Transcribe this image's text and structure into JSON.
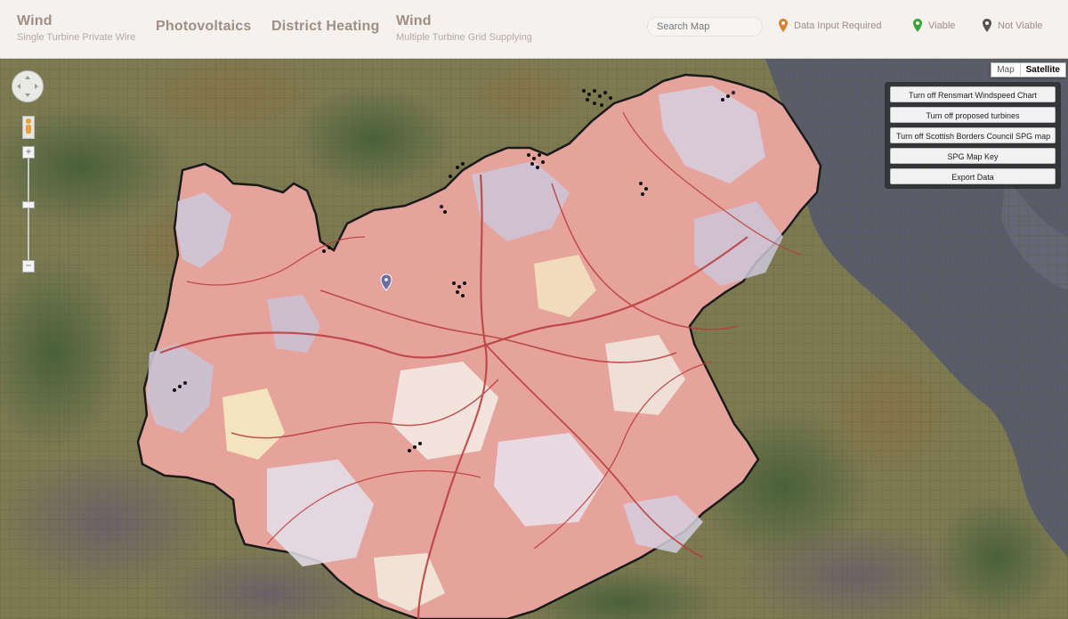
{
  "nav": {
    "items": [
      {
        "title": "Wind",
        "subtitle": "Single Turbine Private Wire"
      },
      {
        "title": "Photovoltaics",
        "subtitle": ""
      },
      {
        "title": "District Heating",
        "subtitle": ""
      },
      {
        "title": "Wind",
        "subtitle": "Multiple Turbine Grid Supplying"
      }
    ]
  },
  "search": {
    "placeholder": "Search Map"
  },
  "legend": {
    "items": [
      {
        "label": "Data Input Required",
        "color": "#d9822b",
        "icon": "map-pin-icon"
      },
      {
        "label": "Viable",
        "color": "#3aa33a",
        "icon": "map-pin-icon"
      },
      {
        "label": "Not Viable",
        "color": "#555555",
        "icon": "map-pin-icon"
      }
    ]
  },
  "map": {
    "type_control": {
      "map_label": "Map",
      "satellite_label": "Satellite",
      "selected": "Satellite"
    },
    "panel_buttons": [
      "Turn off Rensmart Windspeed Chart",
      "Turn off proposed turbines",
      "Turn off Scottish Borders Council SPG map",
      "SPG Map Key",
      "Export Data"
    ],
    "colors": {
      "land": "#7d7a52",
      "sea": "#5a5c6a",
      "region_pink": "#e8a09a",
      "region_lavender": "#c9c3d6",
      "roads": "#b83a3a"
    },
    "icons": [
      "pan-control-icon",
      "pegman-icon",
      "zoom-in-icon",
      "zoom-out-icon"
    ]
  }
}
